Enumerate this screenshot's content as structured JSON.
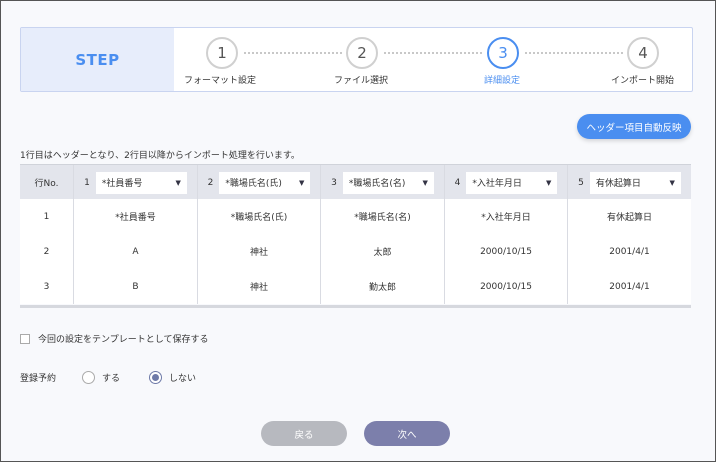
{
  "stepper": {
    "title": "STEP",
    "steps": [
      {
        "num": "1",
        "label": "フォーマット設定"
      },
      {
        "num": "2",
        "label": "ファイル選択"
      },
      {
        "num": "3",
        "label": "詳細設定"
      },
      {
        "num": "4",
        "label": "インポート開始"
      }
    ],
    "active_step": 3
  },
  "auto_header_button": "ヘッダー項目自動反映",
  "note": "1行目はヘッダーとなり、2行目以降からインポート処理を行います。",
  "table": {
    "row_no_header": "行No.",
    "columns": [
      {
        "num": "1",
        "select": "*社員番号"
      },
      {
        "num": "2",
        "select": "*職場氏名(氏)"
      },
      {
        "num": "3",
        "select": "*職場氏名(名)"
      },
      {
        "num": "4",
        "select": "*入社年月日"
      },
      {
        "num": "5",
        "select": "有休起算日"
      }
    ],
    "rows": [
      {
        "no": "1",
        "cells": [
          "*社員番号",
          "*職場氏名(氏)",
          "*職場氏名(名)",
          "*入社年月日",
          "有休起算日"
        ]
      },
      {
        "no": "2",
        "cells": [
          "A",
          "神社",
          "太郎",
          "2000/10/15",
          "2001/4/1"
        ]
      },
      {
        "no": "3",
        "cells": [
          "B",
          "神社",
          "勤太郎",
          "2000/10/15",
          "2001/4/1"
        ]
      }
    ]
  },
  "save_template_label": "今回の設定をテンプレートとして保存する",
  "reservation": {
    "label": "登録予約",
    "options": [
      "する",
      "しない"
    ],
    "selected": "しない"
  },
  "buttons": {
    "back": "戻る",
    "next": "次へ"
  },
  "colors": {
    "accent": "#4a8ef0",
    "next_button": "#7c7fab",
    "back_button": "#b7b9bf"
  }
}
